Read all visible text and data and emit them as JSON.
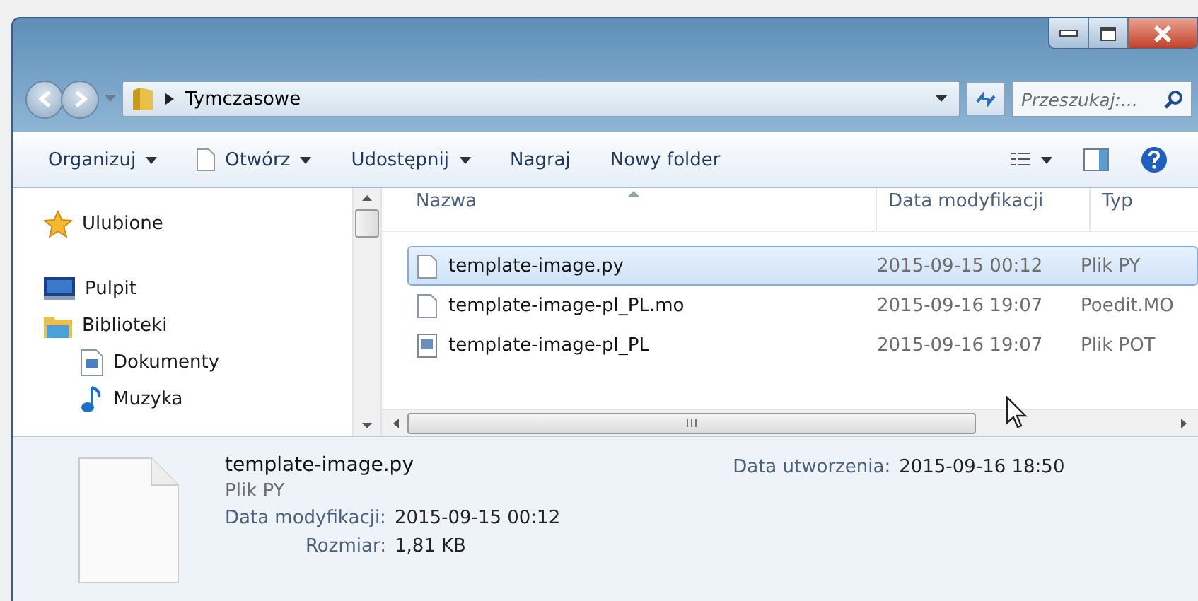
{
  "address": {
    "path": "Tymczasowe",
    "search_placeholder": "Przeszukaj:..."
  },
  "toolbar": [
    {
      "label": "Organizuj",
      "kind": "menu"
    },
    {
      "label": "Otwórz",
      "kind": "open"
    },
    {
      "label": "Udostępnij",
      "kind": "menu"
    },
    {
      "label": "Nagraj",
      "kind": "plain"
    },
    {
      "label": "Nowy folder",
      "kind": "plain"
    }
  ],
  "sidebar": {
    "items": [
      {
        "label": "Ulubione",
        "kind": "star"
      },
      {
        "label": "Pulpit",
        "kind": "desktop"
      },
      {
        "label": "Biblioteki",
        "kind": "library",
        "children": [
          {
            "label": "Dokumenty",
            "kind": "document"
          },
          {
            "label": "Muzyka",
            "kind": "music"
          }
        ]
      }
    ]
  },
  "table": {
    "columns": [
      "Nazwa",
      "Data modyfikacji",
      "Typ"
    ],
    "rows": [
      {
        "name": "template-image.py",
        "date": "2015-09-15 00:12",
        "type": "Plik PY",
        "kind": "blank",
        "selected": true
      },
      {
        "name": "template-image-pl_PL.mo",
        "date": "2015-09-16 19:07",
        "type": "Poedit.MO",
        "kind": "blank",
        "selected": false
      },
      {
        "name": "template-image-pl_PL",
        "date": "2015-09-16 19:07",
        "type": "Plik POT",
        "kind": "text",
        "selected": false
      }
    ]
  },
  "details": {
    "name": "template-image.py",
    "type": "Plik PY",
    "fields": [
      {
        "label": "Data modyfikacji:",
        "value": "2015-09-15 00:12"
      },
      {
        "label": "Rozmiar:",
        "value": "1,81 KB"
      }
    ],
    "side_fields": [
      {
        "label": "Data utworzenia:",
        "value": "2015-09-16 18:50"
      }
    ]
  }
}
